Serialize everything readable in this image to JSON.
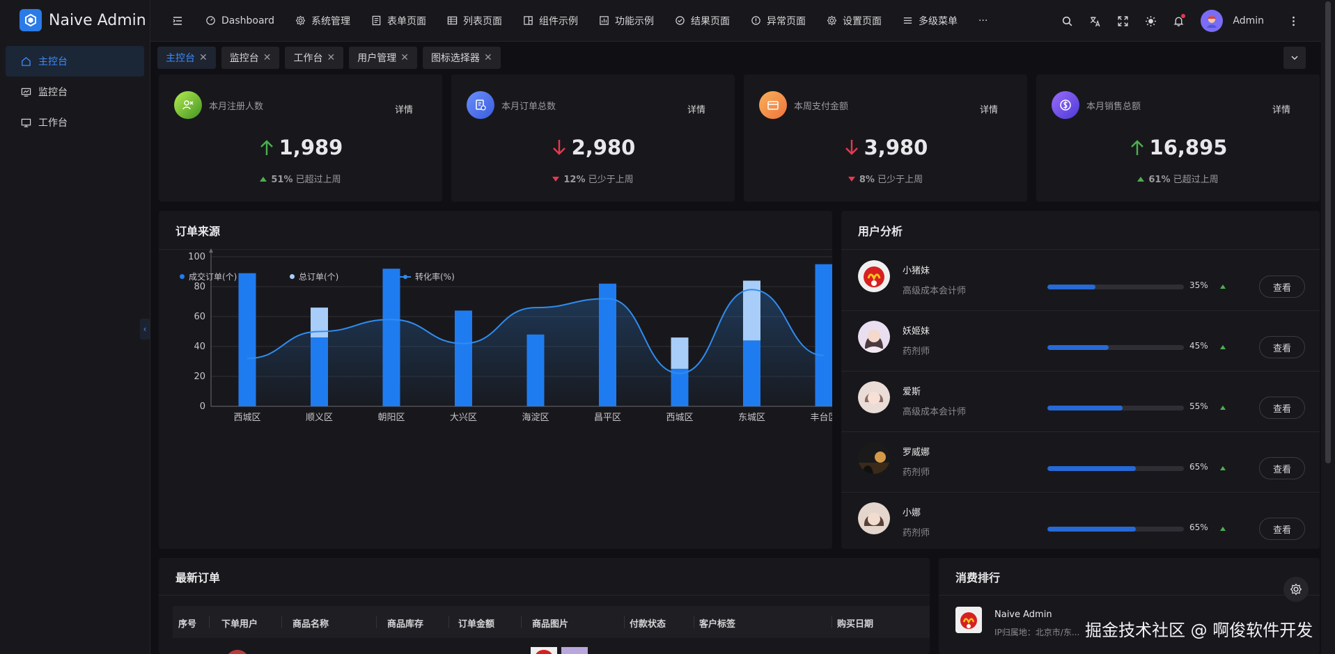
{
  "app": {
    "name": "Naive Admin"
  },
  "sidebar": {
    "items": [
      {
        "label": "主控台",
        "active": true
      },
      {
        "label": "监控台",
        "active": false
      },
      {
        "label": "工作台",
        "active": false
      }
    ]
  },
  "topnav": {
    "items": [
      {
        "label": "Dashboard",
        "icon": "dashboard-icon"
      },
      {
        "label": "系统管理",
        "icon": "gear-icon"
      },
      {
        "label": "表单页面",
        "icon": "form-icon"
      },
      {
        "label": "列表页面",
        "icon": "table-icon"
      },
      {
        "label": "组件示例",
        "icon": "component-icon"
      },
      {
        "label": "功能示例",
        "icon": "feature-icon"
      },
      {
        "label": "结果页面",
        "icon": "check-circle-icon"
      },
      {
        "label": "异常页面",
        "icon": "alert-circle-icon"
      },
      {
        "label": "设置页面",
        "icon": "gear-icon"
      },
      {
        "label": "多级菜单",
        "icon": "list-icon"
      }
    ],
    "more": "···",
    "username": "Admin"
  },
  "tabs": [
    {
      "label": "主控台",
      "active": true
    },
    {
      "label": "监控台",
      "active": false
    },
    {
      "label": "工作台",
      "active": false
    },
    {
      "label": "用户管理",
      "active": false
    },
    {
      "label": "图标选择器",
      "active": false
    }
  ],
  "stats": [
    {
      "title": "本月注册人数",
      "detail": "详情",
      "value": "1,989",
      "trend": "up",
      "percent": "51%",
      "note": "已超过上周",
      "color": "#7ed321"
    },
    {
      "title": "本月订单总数",
      "detail": "详情",
      "value": "2,980",
      "trend": "down",
      "percent": "12%",
      "note": "已少于上周",
      "color": "#4a7cf6"
    },
    {
      "title": "本周支付金额",
      "detail": "详情",
      "value": "3,980",
      "trend": "down",
      "percent": "8%",
      "note": "已少于上周",
      "color": "#f59a3c"
    },
    {
      "title": "本月销售总额",
      "detail": "详情",
      "value": "16,895",
      "trend": "up",
      "percent": "61%",
      "note": "已超过上周",
      "color": "#7a4af0"
    }
  ],
  "order_source": {
    "title": "订单来源"
  },
  "chart_data": {
    "type": "bar",
    "categories": [
      "西城区",
      "顺义区",
      "朝阳区",
      "大兴区",
      "海淀区",
      "昌平区",
      "西城区",
      "东城区",
      "丰台区"
    ],
    "series": [
      {
        "name": "成交订单(个)",
        "type": "bar",
        "values": [
          89,
          46,
          92,
          64,
          48,
          82,
          25,
          44,
          95
        ]
      },
      {
        "name": "总订单(个)",
        "type": "bar",
        "values": [
          89,
          66,
          92,
          64,
          48,
          82,
          46,
          84,
          95
        ]
      },
      {
        "name": "转化率(%)",
        "type": "line",
        "values": [
          32,
          50,
          58,
          42,
          66,
          72,
          22,
          78,
          34
        ]
      }
    ],
    "ylim": [
      0,
      100
    ],
    "yticks": [
      0,
      20,
      40,
      60,
      80,
      100
    ],
    "colors": {
      "deal": "#1f7cf0",
      "total": "#a7cdf8",
      "rate": "#2f8cf0"
    }
  },
  "user_analysis": {
    "title": "用户分析",
    "button": "查看",
    "users": [
      {
        "name": "小猪妹",
        "role": "高级成本会计师",
        "progress": 35,
        "percent": "35%"
      },
      {
        "name": "妖姬妹",
        "role": "药剂师",
        "progress": 45,
        "percent": "45%"
      },
      {
        "name": "爱斯",
        "role": "高级成本会计师",
        "progress": 55,
        "percent": "55%"
      },
      {
        "name": "罗威娜",
        "role": "药剂师",
        "progress": 65,
        "percent": "65%"
      },
      {
        "name": "小娜",
        "role": "药剂师",
        "progress": 65,
        "percent": "65%"
      }
    ]
  },
  "orders": {
    "title": "最新订单",
    "columns": [
      "序号",
      "下单用户",
      "商品名称",
      "商品库存",
      "订单金额",
      "商品图片",
      "付款状态",
      "客户标签",
      "购买日期"
    ]
  },
  "ranking": {
    "title": "消费排行",
    "name": "Naive Admin",
    "ip": "IP归属地：北京市/东..."
  },
  "watermark": "掘金技术社区 @ 啊俊软件开发"
}
